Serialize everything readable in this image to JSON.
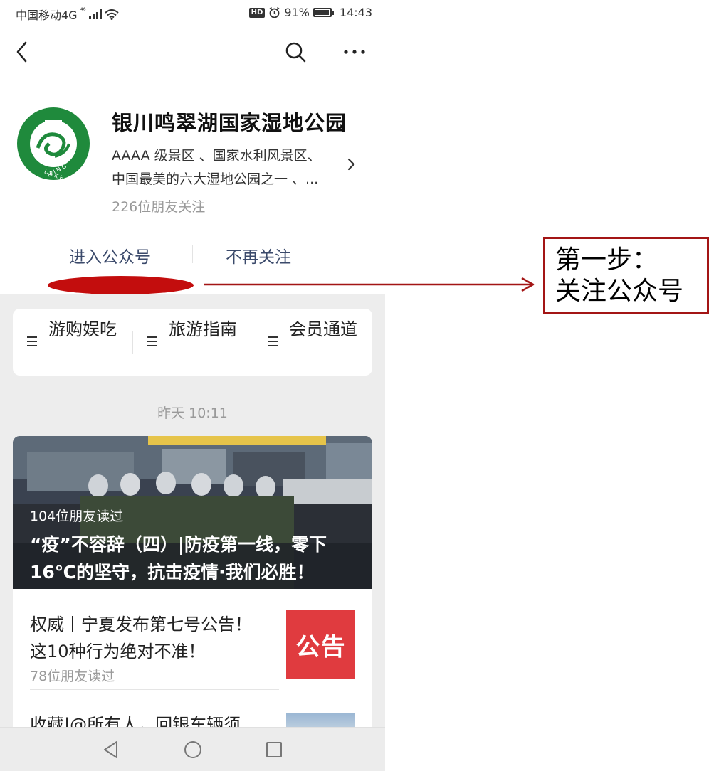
{
  "status_bar": {
    "carrier": "中国移动4G",
    "network_badge": "⁴⁶",
    "hd_badge": "HD",
    "battery": "91%",
    "time": "14:43"
  },
  "navbar": {
    "back_icon": "chevron-left-icon",
    "search_icon": "search-icon",
    "more_icon": "more-dots-icon"
  },
  "profile": {
    "name": "银川鸣翠湖国家湿地公园",
    "desc_line1": "AAAA 级景区 、国家水利风景区、",
    "desc_line2": "中国最美的六大湿地公园之一 、...",
    "followers": "226位朋友关注",
    "logo_text": "MINGCUI LAKE",
    "logo_color": "#1f8a3c"
  },
  "actions": {
    "enter": "进入公众号",
    "unfollow": "不再关注"
  },
  "menu": {
    "items": [
      {
        "label": "游购娱吃"
      },
      {
        "label": "旅游指南"
      },
      {
        "label": "会员通道"
      }
    ]
  },
  "feed": {
    "timestamp": "昨天 10:11",
    "main": {
      "reads": "104位朋友读过",
      "title_line1": "“疫”不容辞（四）|防疫第一线，零下",
      "title_line2": "16℃的坚守，抗击疫情·我们必胜！"
    },
    "sub1": {
      "title_line1": "权威丨宁夏发布第七号公告！",
      "title_line2": "这10种行为绝对不准！",
      "reads": "78位朋友读过",
      "thumb_text": "公告"
    },
    "sub2": {
      "title": "收藏|@所有人，回银车辆须"
    }
  },
  "annotation": {
    "line1": "第一步：",
    "line2": "关注公众号",
    "color": "#a31515"
  },
  "colors": {
    "accent_text": "#3b4a6b",
    "highlight_red": "#c30d0d",
    "bg_gray": "#ededed"
  }
}
